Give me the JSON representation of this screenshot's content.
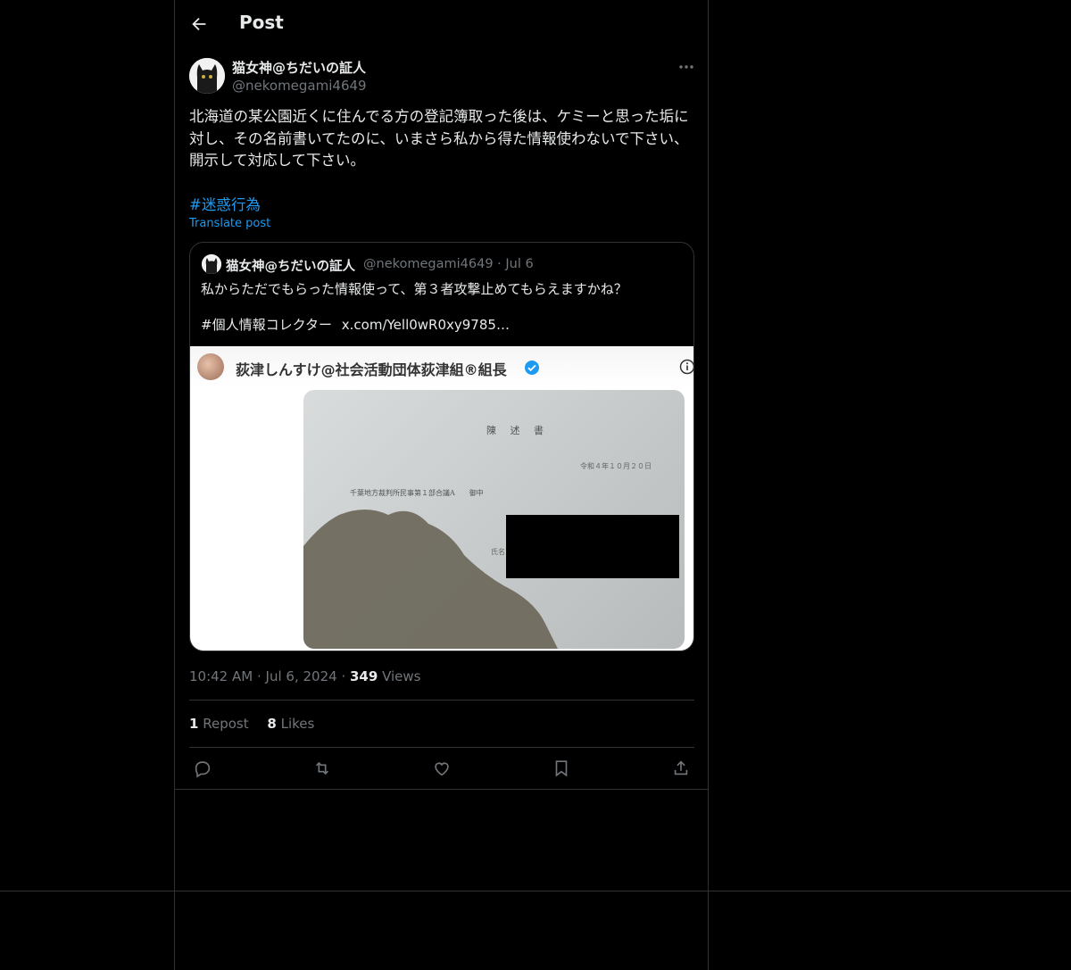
{
  "header": {
    "title": "Post"
  },
  "post": {
    "display_name": "猫女神@ちだいの証人",
    "handle": "@nekomegami4649",
    "text": "北海道の某公園近くに住んでる方の登記簿取った後は、ケミーと思った垢に対し、その名前書いてたのに、いまさら私から得た情報使わないで下さい、開示して対応して下さい。",
    "hashtag": "#迷惑行為",
    "translate_label": "Translate post"
  },
  "quote": {
    "display_name": "猫女神@ちだいの証人",
    "handle": "@nekomegami4649",
    "date": "Jul 6",
    "text_line1": "私からただでもらった情報使って、第３者攻撃止めてもらえますかね？",
    "hashtag": "#個人情報コレクター",
    "link": "x.com/Yell0wR0xy9785…",
    "image": {
      "account_name": "荻津しんすけ@社会活動団体荻津組®組長",
      "doc_title": "陳 述 書",
      "doc_date": "令和４年１０月２０日",
      "doc_court": "千葉地方裁判所民事第１部合議A　　御中",
      "doc_name": "氏名"
    }
  },
  "meta": {
    "time": "10:42 AM",
    "date": "Jul 6, 2024",
    "views_count": "349",
    "views_label": "Views"
  },
  "stats": {
    "reposts_count": "1",
    "reposts_label": "Repost",
    "likes_count": "8",
    "likes_label": "Likes"
  },
  "icons": [
    "back-arrow-icon",
    "more-icon",
    "reply-icon",
    "repost-icon",
    "like-icon",
    "bookmark-icon",
    "share-icon",
    "verified-icon",
    "info-icon"
  ],
  "colors": {
    "background": "#000000",
    "text": "#e7e9ea",
    "secondary": "#71767b",
    "accent": "#1d9bf0",
    "border": "#2f3336"
  }
}
